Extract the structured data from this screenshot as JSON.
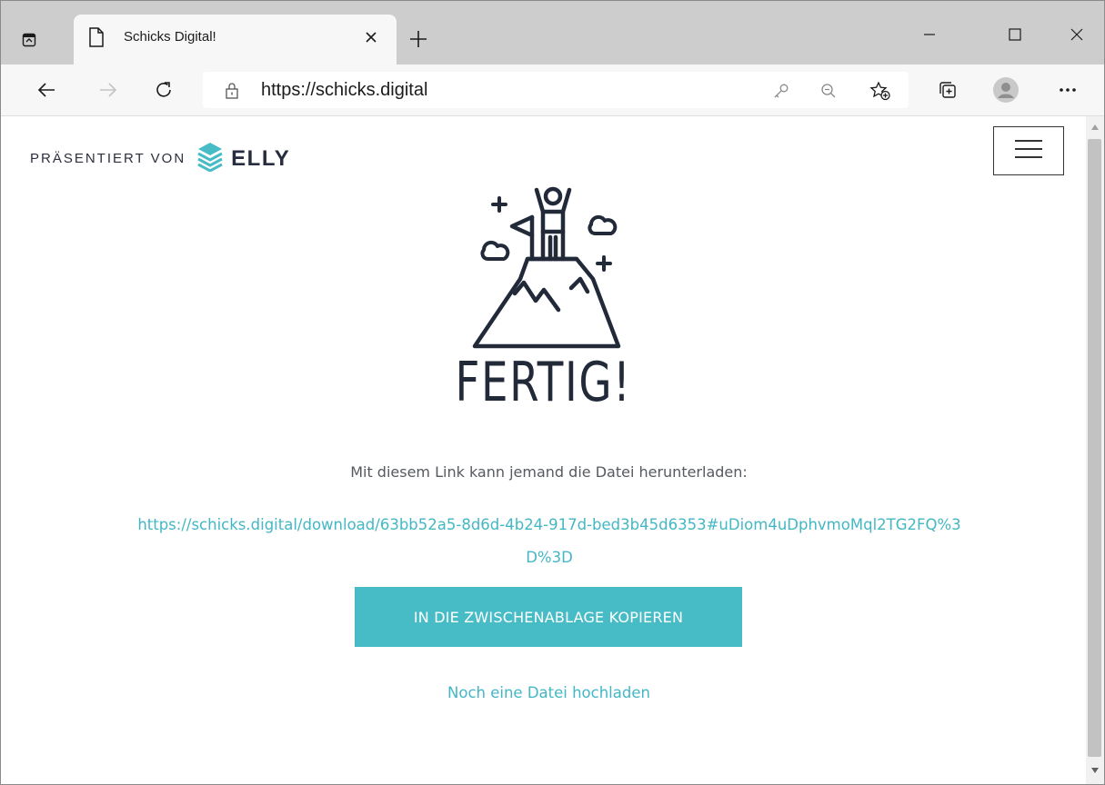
{
  "browser": {
    "tab_title": "Schicks Digital!",
    "address_url": "https://schicks.digital",
    "icons": {
      "tab_actions": "tab-actions-icon",
      "favicon": "page-icon",
      "tab_close": "close-icon",
      "new_tab": "plus-icon",
      "minimize": "minimize-icon",
      "maximize": "maximize-icon",
      "close_window": "close-icon",
      "back": "arrow-left-icon",
      "forward": "arrow-right-icon",
      "refresh": "refresh-icon",
      "lock": "lock-icon",
      "key": "key-icon",
      "zoom_out": "zoom-out-icon",
      "favorites": "star-add-icon",
      "collections": "collections-icon",
      "profile": "avatar-icon",
      "more": "more-icon"
    }
  },
  "page": {
    "presented_by": "PRÄSENTIERT VON",
    "brand_name": "ELLY",
    "title": "FERTIG!",
    "info_text": "Mit diesem Link kann jemand die Datei herunterladen:",
    "download_link": "https://schicks.digital/download/63bb52a5-8d6d-4b24-917d-bed3b45d6353#uDiom4uDphvmoMql2TG2FQ%3D%3D",
    "copy_button": "IN DIE ZWISCHENABLAGE KOPIEREN",
    "upload_again": "Noch eine Datei hochladen"
  },
  "colors": {
    "accent": "#47bcc7",
    "link": "#44b7c4",
    "text_dark": "#222a3a",
    "text_body": "#555a60",
    "tabstrip_bg": "#cdcdcd",
    "toolbar_bg": "#f7f7f7"
  }
}
